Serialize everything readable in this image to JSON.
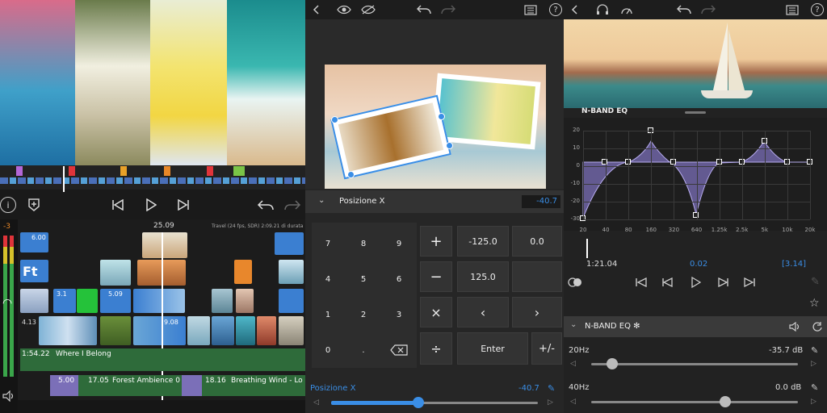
{
  "left": {
    "timeline_time": "25.09",
    "project_info": "Travel (24 fps, SDR) 2:09.21 di durata",
    "level_marker": "-3",
    "clips": {
      "c1": "6.00",
      "c2": "5.09",
      "c3": "5.09",
      "c4": "3.1",
      "c5": "4.13",
      "c6": "9.08"
    },
    "audio1": {
      "time": "1:54.22",
      "title": "Where I Belong"
    },
    "audio2": {
      "dur": "5.00",
      "time": "17.05",
      "title": "Forest Ambience 0"
    },
    "audio3": {
      "time": "18.16",
      "title": "Breathing Wind - Lo"
    }
  },
  "middle": {
    "param_label": "Posizione X",
    "param_value": "-40.7",
    "keypad": [
      [
        "7",
        "8",
        "9"
      ],
      [
        "4",
        "5",
        "6"
      ],
      [
        "1",
        "2",
        "3"
      ],
      [
        "0",
        ".",
        ""
      ]
    ],
    "preset_1": "-125.0",
    "preset_2": "0.0",
    "preset_3": "125.0",
    "enter_label": "Enter",
    "sign_label": "+/-",
    "bottom_label": "Posizione X",
    "bottom_value": "-40.7",
    "slider_fraction": 0.42
  },
  "right": {
    "eq_label": "N-BAND EQ",
    "y_ticks": [
      "20",
      "10",
      "0",
      "-10",
      "-20",
      "-30"
    ],
    "x_ticks": [
      "20",
      "40",
      "80",
      "160",
      "320",
      "640",
      "1.25k",
      "2.5k",
      "5k",
      "10k",
      "20k"
    ],
    "time_pos": "1:21.04",
    "time_mid": "0.02",
    "time_end": "[3.14]",
    "section_title": "N-BAND EQ ✻",
    "band1": {
      "label": "20Hz",
      "value": "-35.7 dB",
      "fraction": 0.1
    },
    "band2": {
      "label": "40Hz",
      "value": "0.0 dB",
      "fraction": 0.65
    }
  },
  "colors": {
    "accent": "#3a8ee6",
    "eq_fill": "#7b6fb8",
    "audio_green": "#2e6b3a"
  }
}
